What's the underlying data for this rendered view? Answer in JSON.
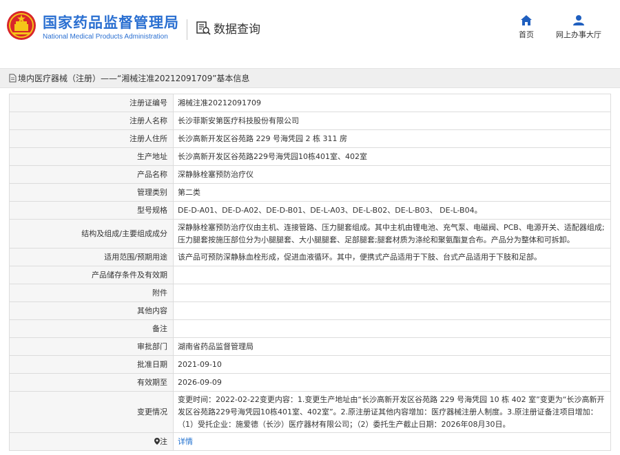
{
  "header": {
    "org_name_cn": "国家药品监督管理局",
    "org_name_en": "National Medical Products Administration",
    "section_title": "数据查询",
    "nav": [
      {
        "label": "首页",
        "icon": "home-icon"
      },
      {
        "label": "网上办事大厅",
        "icon": "user-icon"
      }
    ]
  },
  "breadcrumb": {
    "text": "境内医疗器械（注册）——“湘械注准20212091709”基本信息",
    "icon": "document-icon"
  },
  "colors": {
    "brand_blue": "#2a6fd1",
    "label_bg": "#f6f6f6",
    "title_bar_bg": "#efefef",
    "link": "#1e6fcf"
  },
  "rows": [
    {
      "label": "注册证编号",
      "value": "湘械注准20212091709"
    },
    {
      "label": "注册人名称",
      "value": "长沙菲斯安第医疗科技股份有限公司"
    },
    {
      "label": "注册人住所",
      "value": "长沙高新开发区谷苑路 229 号海凭园 2 栋 311 房"
    },
    {
      "label": "生产地址",
      "value": "长沙高新开发区谷苑路229号海凭园10栋401室、402室"
    },
    {
      "label": "产品名称",
      "value": "深静脉栓塞预防治疗仪"
    },
    {
      "label": "管理类别",
      "value": "第二类"
    },
    {
      "label": "型号规格",
      "value": "DE-D-A01、DE-D-A02、DE-D-B01、DE-L-A03、DE-L-B02、DE-L-B03、 DE-L-B04。"
    },
    {
      "label": "结构及组成/主要组成成分",
      "value": "深静脉栓塞预防治疗仪由主机、连接管路、压力腿套组成。其中主机由锂电池、充气泵、电磁阀、PCB、电源开关、适配器组成;压力腿套按施压部位分为小腿腿套、大小腿腿套、足部腿套;腿套材质为涤纶和聚氨酯复合布。产品分为整体和可拆卸。"
    },
    {
      "label": "适用范围/预期用途",
      "value": "该产品可预防深静脉血栓形成，促进血液循环。其中，便携式产品适用于下肢、台式产品适用于下肢和足部。"
    },
    {
      "label": "产品储存条件及有效期",
      "value": ""
    },
    {
      "label": "附件",
      "value": ""
    },
    {
      "label": "其他内容",
      "value": ""
    },
    {
      "label": "备注",
      "value": ""
    },
    {
      "label": "审批部门",
      "value": "湖南省药品监督管理局"
    },
    {
      "label": "批准日期",
      "value": "2021-09-10"
    },
    {
      "label": "有效期至",
      "value": "2026-09-09"
    },
    {
      "label": "变更情况",
      "value": "变更时间：2022-02-22变更内容：1.变更生产地址由“长沙高新开发区谷苑路 229 号海凭园 10 栋 402 室”变更为“长沙高新开发区谷苑路229号海凭园10栋401室、402室”。2.原注册证其他内容增加：医疗器械注册人制度。3.原注册证备注项目增加：（1）受托企业：施爱德（长沙）医疗器材有限公司；（2）委托生产截止日期：2026年08月30日。"
    }
  ],
  "note_row": {
    "label": "注",
    "icon": "location-pin-icon",
    "value": "详情"
  }
}
